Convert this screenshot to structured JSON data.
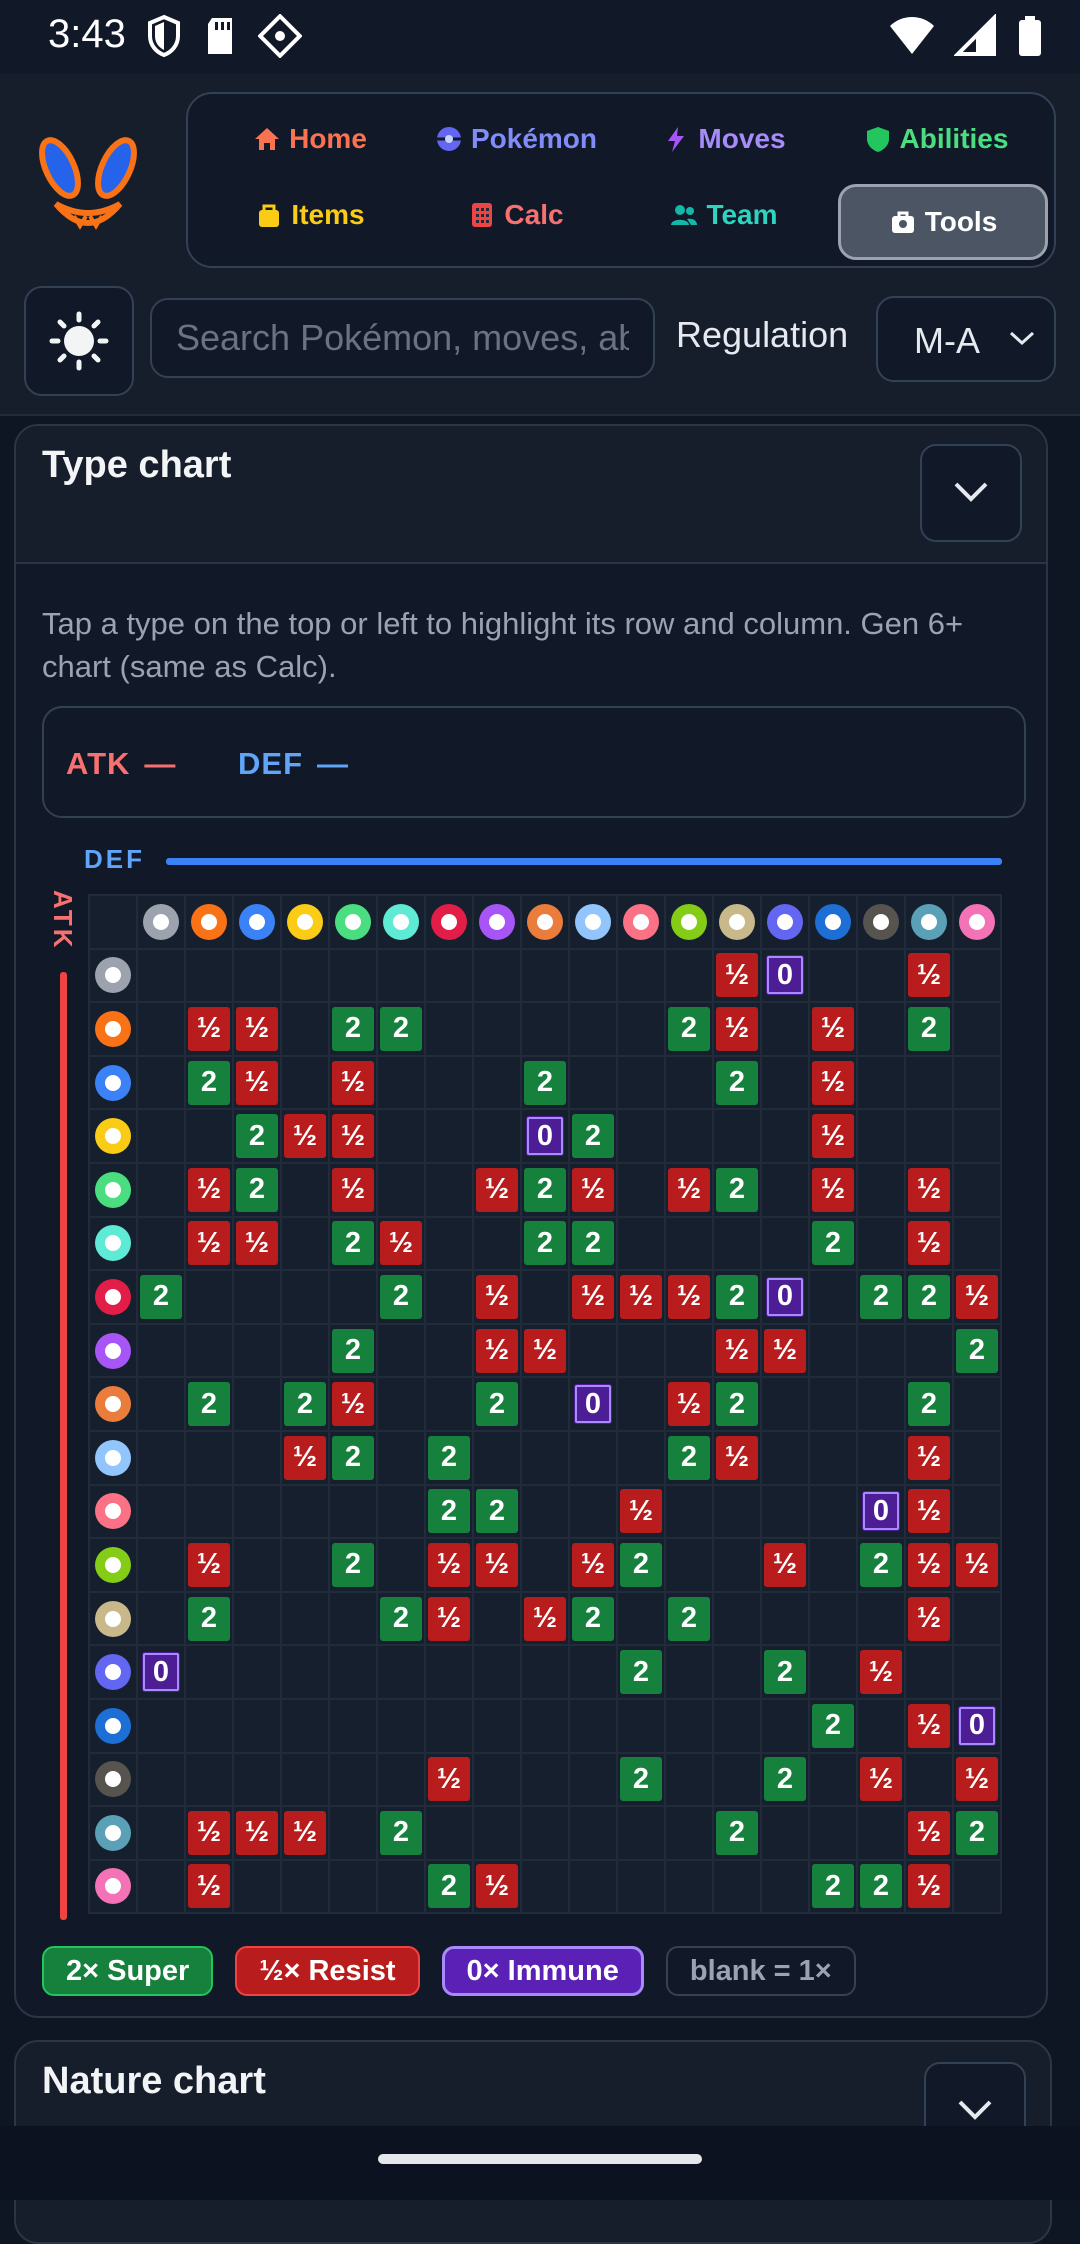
{
  "status_bar": {
    "time": "3:43"
  },
  "nav": {
    "items": [
      {
        "label": "Home",
        "color": "#f97350",
        "icon": "home-icon"
      },
      {
        "label": "Pokémon",
        "color": "#818cf8",
        "icon": "pokeball-icon"
      },
      {
        "label": "Moves",
        "color": "#a78bfa",
        "icon": "bolt-icon"
      },
      {
        "label": "Abilities",
        "color": "#4ade80",
        "icon": "shield-icon"
      },
      {
        "label": "Items",
        "color": "#facc15",
        "icon": "bag-icon"
      },
      {
        "label": "Calc",
        "color": "#f87171",
        "icon": "calculator-icon"
      },
      {
        "label": "Team",
        "color": "#2dd4bf",
        "icon": "team-icon"
      },
      {
        "label": "Tools",
        "color": "#ffffff",
        "icon": "toolbox-icon",
        "active": true
      }
    ]
  },
  "search": {
    "placeholder": "Search Pokémon, moves, abilities…"
  },
  "regulation": {
    "label": "Regulation",
    "value": "M-A"
  },
  "type_chart": {
    "title": "Type chart",
    "description": "Tap a type on the top or left to highlight its row and column. Gen 6+ chart (same as Calc).",
    "highlight": {
      "atk_label": "ATK",
      "atk_value": "—",
      "def_label": "DEF",
      "def_value": "—"
    },
    "def_axis_label": "DEF",
    "atk_axis_label": "ATK",
    "types": [
      {
        "name": "normal",
        "color": "#9ca3af"
      },
      {
        "name": "fire",
        "color": "#f97316"
      },
      {
        "name": "water",
        "color": "#3b82f6"
      },
      {
        "name": "electric",
        "color": "#facc15"
      },
      {
        "name": "grass",
        "color": "#4ade80"
      },
      {
        "name": "ice",
        "color": "#5eead4"
      },
      {
        "name": "fighting",
        "color": "#e11d48"
      },
      {
        "name": "poison",
        "color": "#a855f7"
      },
      {
        "name": "ground",
        "color": "#ea7c3c"
      },
      {
        "name": "flying",
        "color": "#93c5fd"
      },
      {
        "name": "psychic",
        "color": "#fb7185"
      },
      {
        "name": "bug",
        "color": "#84cc16"
      },
      {
        "name": "rock",
        "color": "#c8b88a"
      },
      {
        "name": "ghost",
        "color": "#6366f1"
      },
      {
        "name": "dragon",
        "color": "#1d6fd6"
      },
      {
        "name": "dark",
        "color": "#57534e"
      },
      {
        "name": "steel",
        "color": "#5aa1b8"
      },
      {
        "name": "fairy",
        "color": "#f472b6"
      }
    ],
    "matrix": [
      [
        "",
        "",
        "",
        "",
        "",
        "",
        "",
        "",
        "",
        "",
        "",
        "",
        "½",
        "0",
        "",
        "",
        "½",
        ""
      ],
      [
        "",
        "½",
        "½",
        "",
        "2",
        "2",
        "",
        "",
        "",
        "",
        "",
        "2",
        "½",
        "",
        "½",
        "",
        "2",
        ""
      ],
      [
        "",
        "2",
        "½",
        "",
        "½",
        "",
        "",
        "",
        "2",
        "",
        "",
        "",
        "2",
        "",
        "½",
        "",
        "",
        ""
      ],
      [
        "",
        "",
        "2",
        "½",
        "½",
        "",
        "",
        "",
        "0",
        "2",
        "",
        "",
        "",
        "",
        "½",
        "",
        "",
        ""
      ],
      [
        "",
        "½",
        "2",
        "",
        "½",
        "",
        "",
        "½",
        "2",
        "½",
        "",
        "½",
        "2",
        "",
        "½",
        "",
        "½",
        ""
      ],
      [
        "",
        "½",
        "½",
        "",
        "2",
        "½",
        "",
        "",
        "2",
        "2",
        "",
        "",
        "",
        "",
        "2",
        "",
        "½",
        ""
      ],
      [
        "2",
        "",
        "",
        "",
        "",
        "2",
        "",
        "½",
        "",
        "½",
        "½",
        "½",
        "2",
        "0",
        "",
        "2",
        "2",
        "½"
      ],
      [
        "",
        "",
        "",
        "",
        "2",
        "",
        "",
        "½",
        "½",
        "",
        "",
        "",
        "½",
        "½",
        "",
        "",
        "",
        "2"
      ],
      [
        "",
        "2",
        "",
        "2",
        "½",
        "",
        "",
        "2",
        "",
        "0",
        "",
        "½",
        "2",
        "",
        "",
        "",
        "2",
        ""
      ],
      [
        "",
        "",
        "",
        "½",
        "2",
        "",
        "2",
        "",
        "",
        "",
        "",
        "2",
        "½",
        "",
        "",
        "",
        "½",
        ""
      ],
      [
        "",
        "",
        "",
        "",
        "",
        "",
        "2",
        "2",
        "",
        "",
        "½",
        "",
        "",
        "",
        "",
        "0",
        "½",
        ""
      ],
      [
        "",
        "½",
        "",
        "",
        "2",
        "",
        "½",
        "½",
        "",
        "½",
        "2",
        "",
        "",
        "½",
        "",
        "2",
        "½",
        "½"
      ],
      [
        "",
        "2",
        "",
        "",
        "",
        "2",
        "½",
        "",
        "½",
        "2",
        "",
        "2",
        "",
        "",
        "",
        "",
        "½",
        ""
      ],
      [
        "0",
        "",
        "",
        "",
        "",
        "",
        "",
        "",
        "",
        "",
        "2",
        "",
        "",
        "2",
        "",
        "½",
        "",
        ""
      ],
      [
        "",
        "",
        "",
        "",
        "",
        "",
        "",
        "",
        "",
        "",
        "",
        "",
        "",
        "",
        "2",
        "",
        "½",
        "0"
      ],
      [
        "",
        "",
        "",
        "",
        "",
        "",
        "½",
        "",
        "",
        "",
        "2",
        "",
        "",
        "2",
        "",
        "½",
        "",
        "½"
      ],
      [
        "",
        "½",
        "½",
        "½",
        "",
        "2",
        "",
        "",
        "",
        "",
        "",
        "",
        "2",
        "",
        "",
        "",
        "½",
        "2"
      ],
      [
        "",
        "½",
        "",
        "",
        "",
        "",
        "2",
        "½",
        "",
        "",
        "",
        "",
        "",
        "",
        "2",
        "2",
        "½",
        ""
      ]
    ],
    "legend": {
      "super": "2× Super",
      "resist": "½× Resist",
      "immune": "0× Immune",
      "blank": "blank = 1×"
    }
  },
  "nature_chart": {
    "title": "Nature chart"
  }
}
